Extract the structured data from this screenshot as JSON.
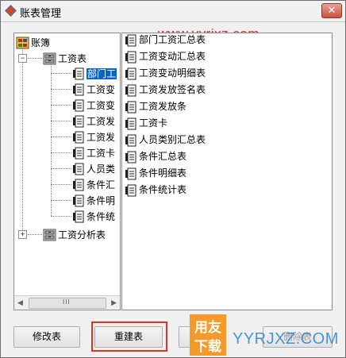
{
  "window": {
    "title": "账表管理",
    "close_label": "✕"
  },
  "watermark_top": "www.yyrjxz.com",
  "tree": {
    "root": "账簿",
    "folder1": "工资表",
    "children": [
      "部门工",
      "工资变",
      "工资变",
      "工资发",
      "工资发",
      "工资卡",
      "人员类",
      "条件汇",
      "条件明",
      "条件统"
    ],
    "folder2": "工资分析表"
  },
  "list": {
    "items": [
      "部门工资汇总表",
      "工资变动汇总表",
      "工资变动明细表",
      "工资发放签名表",
      "工资发放条",
      "工资卡",
      "人员类别汇总表",
      "条件汇总表",
      "条件明细表",
      "条件统计表"
    ]
  },
  "buttons": {
    "modify": "修改表",
    "rebuild": "重建表",
    "delete": "删除表"
  },
  "logo": {
    "top": "用友",
    "bottom": "下载"
  },
  "watermark_bottom": "YYRJXZ.COM",
  "colors": {
    "selection": "#0a64c8",
    "highlight": "#e0302a",
    "watermark": "#ff1a1a"
  }
}
